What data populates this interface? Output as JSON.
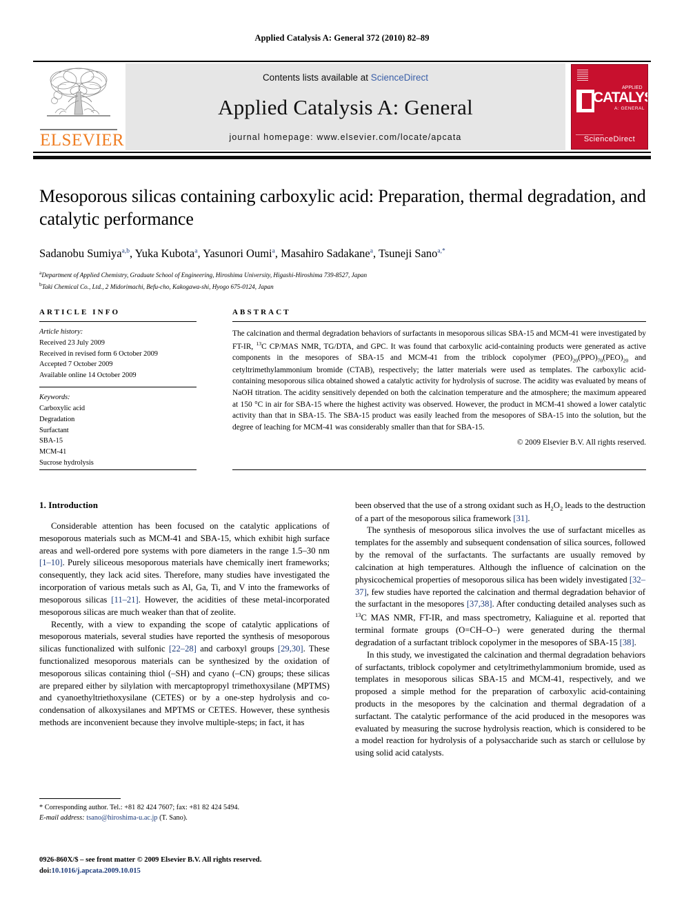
{
  "running_head": "Applied Catalysis A: General 372 (2010) 82–89",
  "masthead": {
    "publisher_name": "ELSEVIER",
    "contents_prefix": "Contents lists available at ",
    "contents_link": "ScienceDirect",
    "journal_title": "Applied Catalysis A: General",
    "homepage": "journal homepage: www.elsevier.com/locate/apcata",
    "cover": {
      "brand": "CATALYSIS",
      "applied": "APPLIED",
      "subtitle": "A: GENERAL",
      "footer_mark": "ScienceDirect"
    }
  },
  "article": {
    "title": "Mesoporous silicas containing carboxylic acid: Preparation, thermal degradation, and catalytic performance",
    "authors": [
      {
        "name": "Sadanobu Sumiya",
        "marks": "a,b"
      },
      {
        "name": "Yuka Kubota",
        "marks": "a"
      },
      {
        "name": "Yasunori Oumi",
        "marks": "a"
      },
      {
        "name": "Masahiro Sadakane",
        "marks": "a"
      },
      {
        "name": "Tsuneji Sano",
        "marks": "a,*"
      }
    ],
    "affiliations": [
      {
        "mark": "a",
        "text": "Department of Applied Chemistry, Graduate School of Engineering, Hiroshima University, Higashi-Hiroshima 739-8527, Japan"
      },
      {
        "mark": "b",
        "text": "Taki Chemical Co., Ltd., 2 Midorimachi, Befu-cho, Kakogawa-shi, Hyogo 675-0124, Japan"
      }
    ]
  },
  "info": {
    "heading": "ARTICLE INFO",
    "history_label": "Article history:",
    "history": [
      "Received 23 July 2009",
      "Received in revised form 6 October 2009",
      "Accepted 7 October 2009",
      "Available online 14 October 2009"
    ],
    "keywords_label": "Keywords:",
    "keywords": [
      "Carboxylic acid",
      "Degradation",
      "Surfactant",
      "SBA-15",
      "MCM-41",
      "Sucrose hydrolysis"
    ]
  },
  "abstract": {
    "heading": "ABSTRACT",
    "text_parts": {
      "p1": "The calcination and thermal degradation behaviors of surfactants in mesoporous silicas SBA-15 and MCM-41 were investigated by FT-IR, ",
      "sup13c": "13",
      "p2": "C CP/MAS NMR, TG/DTA, and GPC. It was found that carboxylic acid-containing products were generated as active components in the mesopores of SBA-15 and MCM-41 from the triblock copolymer (PEO)",
      "sub20a": "20",
      "p3": "(PPO)",
      "sub70": "70",
      "p4": "(PEO)",
      "sub20b": "20",
      "p5": " and cetyltrimethylammonium bromide (CTAB), respectively; the latter materials were used as templates. The carboxylic acid-containing mesoporous silica obtained showed a catalytic activity for hydrolysis of sucrose. The acidity was evaluated by means of NaOH titration. The acidity sensitively depended on both the calcination temperature and the atmosphere; the maximum appeared at 150 °C in air for SBA-15 where the highest activity was observed. However, the product in MCM-41 showed a lower catalytic activity than that in SBA-15. The SBA-15 product was easily leached from the mesopores of SBA-15 into the solution, but the degree of leaching for MCM-41 was considerably smaller than that for SBA-15."
    },
    "copyright": "© 2009 Elsevier B.V. All rights reserved."
  },
  "body": {
    "section_title": "1. Introduction",
    "left_paragraphs": [
      {
        "runs": [
          {
            "t": "Considerable attention has been focused on the catalytic applications of mesoporous materials such as MCM-41 and SBA-15, which exhibit high surface areas and well-ordered pore systems with pore diameters in the range 1.5–30 nm "
          },
          {
            "t": "[1–10]",
            "ref": true
          },
          {
            "t": ". Purely siliceous mesoporous materials have chemically inert frameworks; consequently, they lack acid sites. Therefore, many studies have investigated the incorporation of various metals such as Al, Ga, Ti, and V into the frameworks of mesoporous silicas "
          },
          {
            "t": "[11–21]",
            "ref": true
          },
          {
            "t": ". However, the acidities of these metal-incorporated mesoporous silicas are much weaker than that of zeolite."
          }
        ]
      },
      {
        "runs": [
          {
            "t": "Recently, with a view to expanding the scope of catalytic applications of mesoporous materials, several studies have reported the synthesis of mesoporous silicas functionalized with sulfonic "
          },
          {
            "t": "[22–28]",
            "ref": true
          },
          {
            "t": " and carboxyl groups "
          },
          {
            "t": "[29,30]",
            "ref": true
          },
          {
            "t": ". These functionalized mesoporous materials can be synthesized by the oxidation of mesoporous silicas containing thiol (–SH) and cyano (–CN) groups; these silicas are prepared either by silylation with mercaptopropyl trimethoxysilane (MPTMS) and cyanoethyltriethoxysilane (CETES) or by a one-step hydrolysis and co-condensation of alkoxysilanes and MPTMS or CETES. However, these synthesis methods are inconvenient because they involve multiple-steps; in fact, it has"
          }
        ]
      }
    ],
    "right_paragraphs": [
      {
        "noindent": true,
        "runs": [
          {
            "t": "been observed that the use of a strong oxidant such as H"
          },
          {
            "t": "2",
            "sub": true
          },
          {
            "t": "O"
          },
          {
            "t": "2",
            "sub": true
          },
          {
            "t": " leads to the destruction of a part of the mesoporous silica framework "
          },
          {
            "t": "[31]",
            "ref": true
          },
          {
            "t": "."
          }
        ]
      },
      {
        "runs": [
          {
            "t": "The synthesis of mesoporous silica involves the use of surfactant micelles as templates for the assembly and subsequent condensation of silica sources, followed by the removal of the surfactants. The surfactants are usually removed by calcination at high temperatures. Although the influence of calcination on the physicochemical properties of mesoporous silica has been widely investigated "
          },
          {
            "t": "[32–37]",
            "ref": true
          },
          {
            "t": ", few studies have reported the calcination and thermal degradation behavior of the surfactant in the mesopores "
          },
          {
            "t": "[37,38]",
            "ref": true
          },
          {
            "t": ". After conducting detailed analyses such as "
          },
          {
            "t": "13",
            "sup": true
          },
          {
            "t": "C MAS NMR, FT-IR, and mass spectrometry, Kaliaguine et al. reported that terminal formate groups (O=CH–O–) were generated during the thermal degradation of a surfactant triblock copolymer in the mesopores of SBA-15 "
          },
          {
            "t": "[38]",
            "ref": true
          },
          {
            "t": "."
          }
        ]
      },
      {
        "runs": [
          {
            "t": "In this study, we investigated the calcination and thermal degradation behaviors of surfactants, triblock copolymer and cetyltrimethylammonium bromide, used as templates in mesoporous silicas SBA-15 and MCM-41, respectively, and we proposed a simple method for the preparation of carboxylic acid-containing products in the mesopores by the calcination and thermal degradation of a surfactant. The catalytic performance of the acid produced in the mesopores was evaluated by measuring the sucrose hydrolysis reaction, which is considered to be a model reaction for hydrolysis of a polysaccharide such as starch or cellulose by using solid acid catalysts."
          }
        ]
      }
    ]
  },
  "footnotes": {
    "corresponding": "* Corresponding author. Tel.: +81 82 424 7607; fax: +81 82 424 5494.",
    "email_label": "E-mail address:",
    "email": "tsano@hiroshima-u.ac.jp",
    "email_suffix": "(T. Sano)."
  },
  "issn": {
    "line1": "0926-860X/$ – see front matter © 2009 Elsevier B.V. All rights reserved.",
    "doi_prefix": "doi:",
    "doi": "10.1016/j.apcata.2009.10.015"
  },
  "colors": {
    "elsevier_orange": "#ef7d22",
    "link_blue": "#3a5fa8",
    "ref_blue": "#1b3a7a",
    "cover_red": "#c8102e",
    "masthead_grey": "#e6e6e6"
  }
}
